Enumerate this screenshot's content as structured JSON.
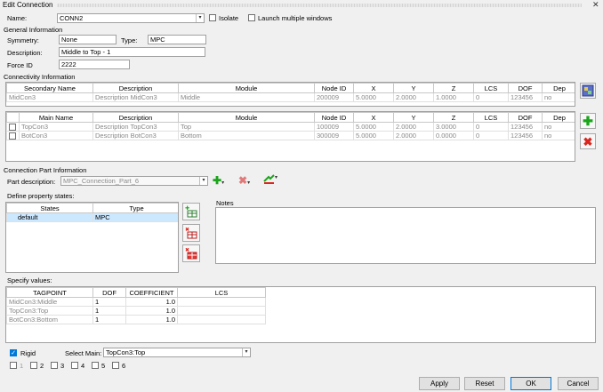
{
  "window": {
    "title": "Edit Connection",
    "close_glyph": "✕"
  },
  "name_row": {
    "label": "Name:",
    "value": "CONN2",
    "isolate_label": "Isolate",
    "launch_label": "Launch multiple windows"
  },
  "general": {
    "heading": "General Information",
    "symmetry_label": "Symmetry:",
    "symmetry_value": "None",
    "type_label": "Type:",
    "type_value": "MPC",
    "description_label": "Description:",
    "description_value": "Middle to Top - 1",
    "force_label": "Force ID",
    "force_value": "2222"
  },
  "connectivity": {
    "heading": "Connectivity Information",
    "secondary_headers": [
      "Secondary Name",
      "Description",
      "Module",
      "Node ID",
      "X",
      "Y",
      "Z",
      "LCS",
      "DOF",
      "Dep"
    ],
    "secondary_rows": [
      [
        "MidCon3",
        "Description MidCon3",
        "Middle",
        "200009",
        "5.0000",
        "2.0000",
        "1.0000",
        "0",
        "123456",
        "no"
      ]
    ],
    "main_headers": [
      "",
      "Main Name",
      "Description",
      "Module",
      "Node ID",
      "X",
      "Y",
      "Z",
      "LCS",
      "DOF",
      "Dep"
    ],
    "main_rows": [
      [
        "",
        "TopCon3",
        "Description TopCon3",
        "Top",
        "100009",
        "5.0000",
        "2.0000",
        "3.0000",
        "0",
        "123456",
        "no"
      ],
      [
        "",
        "BotCon3",
        "Description BotCon3",
        "Bottom",
        "300009",
        "5.0000",
        "2.0000",
        "0.0000",
        "0",
        "123456",
        "no"
      ]
    ]
  },
  "part": {
    "heading": "Connection Part Information",
    "part_label": "Part description:",
    "part_value": "MPC_Connection_Part_6",
    "states_label": "Define property states:",
    "states_headers": [
      "States",
      "Type"
    ],
    "states_rows": [
      [
        "default",
        "MPC"
      ]
    ],
    "notes_label": "Notes"
  },
  "values": {
    "label": "Specify values:",
    "headers": [
      "TAGPOINT",
      "DOF",
      "COEFFICIENT",
      "LCS"
    ],
    "rows": [
      [
        "MidCon3:Middle",
        "1",
        "1.0",
        ""
      ],
      [
        "TopCon3:Top",
        "1",
        "1.0",
        ""
      ],
      [
        "BotCon3:Bottom",
        "1",
        "1.0",
        ""
      ]
    ]
  },
  "bottom": {
    "rigid_label": "Rigid",
    "select_main_label": "Select Main:",
    "select_main_value": "TopCon3:Top",
    "dofs": [
      "1",
      "2",
      "3",
      "4",
      "5",
      "6"
    ]
  },
  "buttons": {
    "apply": "Apply",
    "reset": "Reset",
    "ok": "OK",
    "cancel": "Cancel"
  }
}
